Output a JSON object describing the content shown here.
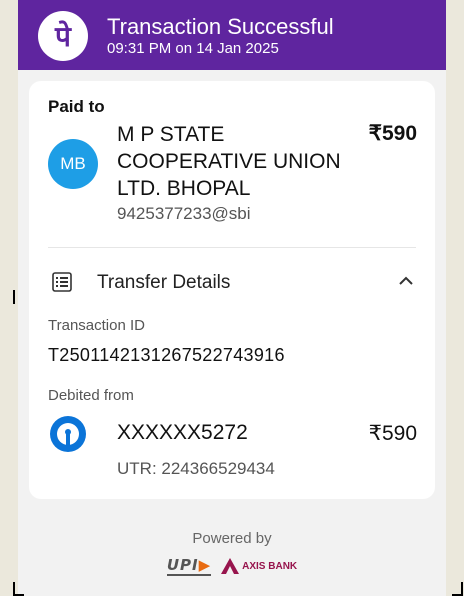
{
  "header": {
    "logo_glyph": "पे",
    "title": "Transaction Successful",
    "datetime": "09:31 PM on 14 Jan 2025",
    "bg_color": "#5f259f"
  },
  "payee": {
    "section_label": "Paid to",
    "avatar_initials": "MB",
    "avatar_color": "#1e9ee6",
    "name": "M P STATE COOPERATIVE UNION LTD. BHOPAL",
    "amount": "₹590",
    "upi_id": "9425377233@sbi"
  },
  "transfer": {
    "section_label": "Transfer Details",
    "icon": "list-document-icon",
    "toggle_icon": "chevron-up-icon",
    "txn_id_label": "Transaction ID",
    "txn_id": "T2501142131267522743916",
    "debited_label": "Debited from",
    "account": "XXXXXX5272",
    "amount": "₹590",
    "utr": "UTR: 224366529434",
    "bank_icon": "sbi-bank-icon"
  },
  "footer": {
    "powered_by": "Powered by",
    "upi_logo": "UPI",
    "bank_name": "AXIS BANK"
  }
}
